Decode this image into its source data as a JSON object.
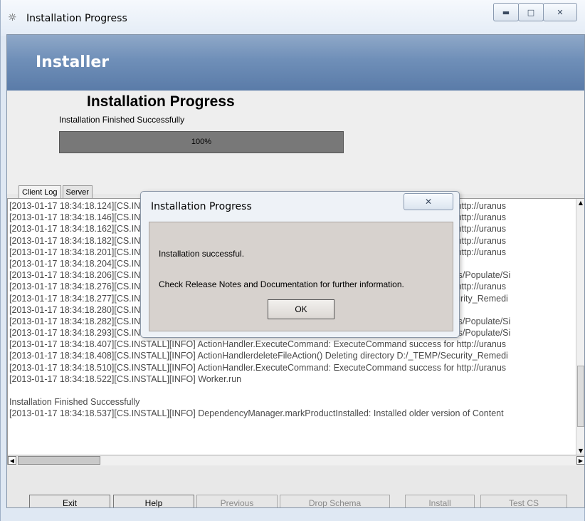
{
  "window": {
    "title": "Installation Progress",
    "icon": "installer-app-icon",
    "controls": [
      "minimize",
      "restore",
      "close"
    ]
  },
  "banner": {
    "title": "Installer"
  },
  "progress": {
    "heading": "Installation Progress",
    "status": "Installation Finished Successfully",
    "percent_label": "100%",
    "value": 1.0
  },
  "tabs": [
    {
      "label": "Client Log",
      "active": true
    },
    {
      "label": "Server",
      "active": false
    }
  ],
  "log": {
    "lines": [
      "[2013-01-17 18:34:18.124][CS.INSTALL][INFO] ActionHandler.ExecuteCommand:  ExecuteCommand success for http://uranus",
      "[2013-01-17 18:34:18.146][CS.INSTALL][INFO] ActionHandler.ExecuteCommand:  ExecuteCommand success for http://uranus",
      "[2013-01-17 18:34:18.162][CS.INSTALL][INFO] ActionHandler.ExecuteCommand:  ExecuteCommand success for http://uranus",
      "[2013-01-17 18:34:18.182][CS.INSTALL][INFO] ActionHandler.ExecuteCommand:  ExecuteCommand success for http://uranus",
      "[2013-01-17 18:34:18.201][CS.INSTALL][INFO] ActionHandler.ExecuteCommand:  ExecuteCommand success for http://uranus",
      "[2013-01-17 18:34:18.204][CS.INSTALL][INFO] ActionHandler.copyFile()  Copying D:\\_TEMP\\Security_Remed",
      "[2013-01-17 18:34:18.206][CS.INSTALL][INFO] ActionHandler.copyFile()  Copying D:/_WCS_PS7/community_blogs/Populate/Si",
      "[2013-01-17 18:34:18.276][CS.INSTALL][INFO] ActionHandler.ExecuteCommand:  ExecuteCommand success for http://uranus",
      "[2013-01-17 18:34:18.277][CS.INSTALL][INFO] ActionHandlerdeleteFileAction()  Deleting directory D:/_TEMP/Security_Remedi",
      "[2013-01-17 18:34:18.280][CS.INSTALL][INFO] ActionHandler.copyFile()  Copying D:\\_TEMP\\Security_Remed",
      "[2013-01-17 18:34:18.282][CS.INSTALL][INFO] ActionHandler.copyFile()  Copying D:/_WCS_PS7/community_blogs/Populate/Si",
      "[2013-01-17 18:34:18.293][CS.INSTALL][INFO] ActionHandler.copyFile()  Copying D:/_WCS_PS7/community_blogs/Populate/Si",
      "[2013-01-17 18:34:18.407][CS.INSTALL][INFO] ActionHandler.ExecuteCommand:  ExecuteCommand success for http://uranus",
      "[2013-01-17 18:34:18.408][CS.INSTALL][INFO] ActionHandlerdeleteFileAction()  Deleting directory D:/_TEMP/Security_Remedi",
      "[2013-01-17 18:34:18.510][CS.INSTALL][INFO] ActionHandler.ExecuteCommand:  ExecuteCommand success for http://uranus",
      "[2013-01-17 18:34:18.522][CS.INSTALL][INFO] Worker.run",
      "",
      "Installation Finished Successfully",
      "[2013-01-17 18:34:18.537][CS.INSTALL][INFO] DependencyManager.markProductInstalled:  Installed older version of Content"
    ]
  },
  "buttons": {
    "exit": "Exit",
    "help": "Help",
    "previous": "Previous",
    "drop_schema": "Drop Schema",
    "install": "Install",
    "test_cs": "Test CS"
  },
  "dialog": {
    "title": "Installation Progress",
    "message_1": "Installation successful.",
    "message_2": "Check Release Notes and Documentation for further information.",
    "ok_label": "OK"
  }
}
